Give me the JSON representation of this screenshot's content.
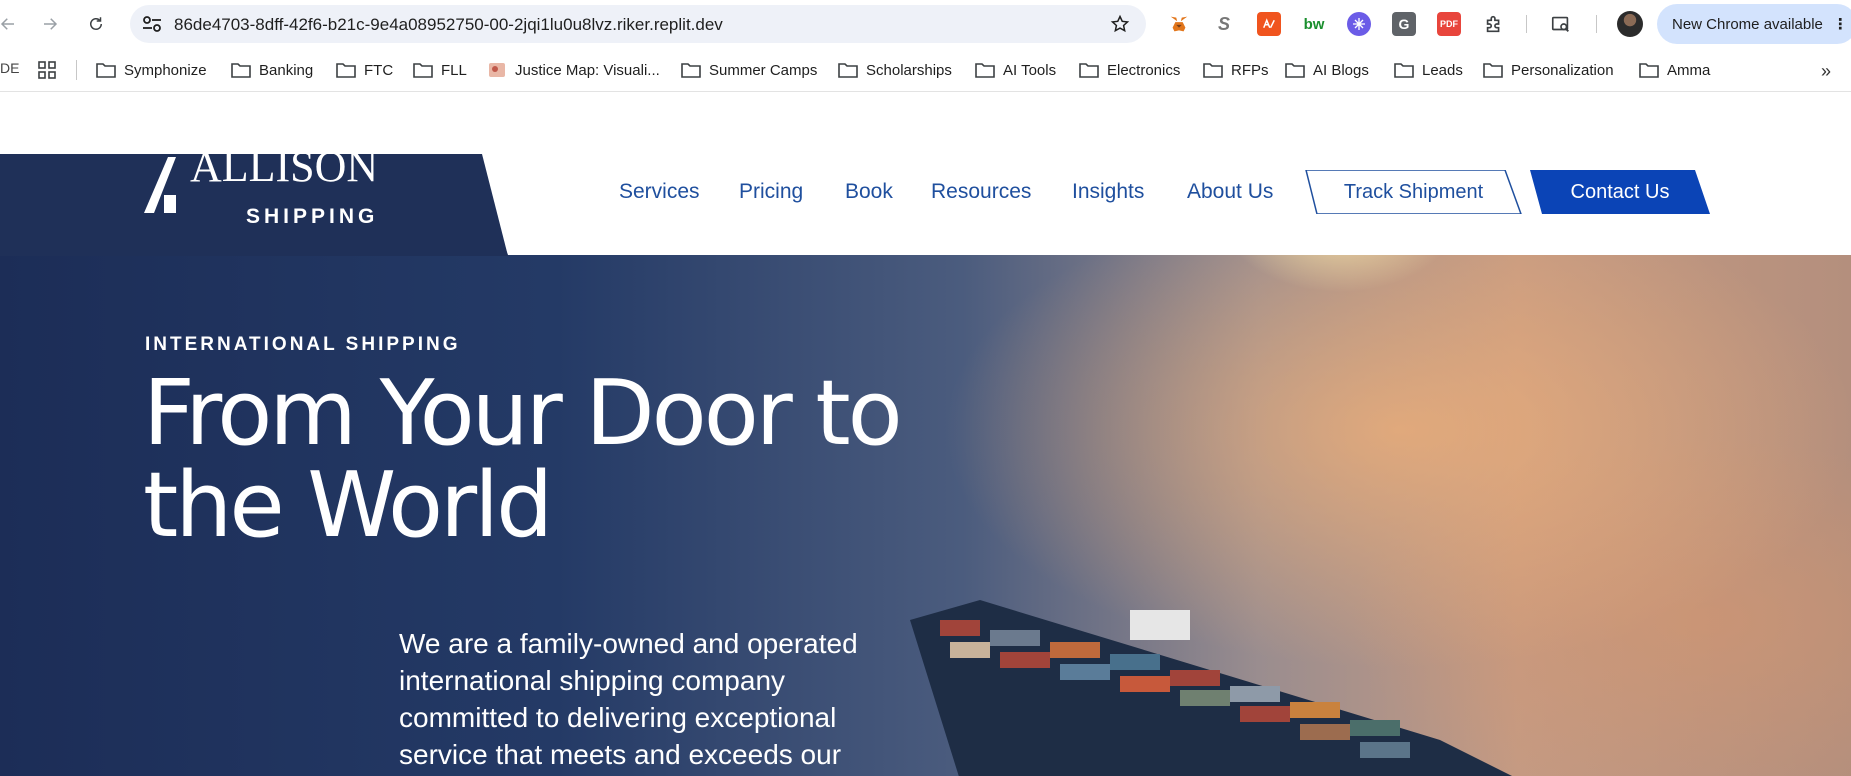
{
  "browser": {
    "url": "86de4703-8dff-42f6-b21c-9e4a08952750-00-2jqi1lu0u8lvz.riker.replit.dev",
    "update_label": "New Chrome available",
    "extensions": [
      "metamask-icon",
      "s-extension-icon",
      "pdf-tool-icon",
      "bw-icon",
      "snowflake-icon",
      "g-icon",
      "pdf-icon",
      "puzzle-icon"
    ],
    "extension_text": {
      "g": "G",
      "bw": "bw",
      "pdf": "PDF",
      "s": "S"
    }
  },
  "bookmarks": {
    "edge_label": "DE",
    "items": [
      {
        "label": "Symphonize"
      },
      {
        "label": "Banking"
      },
      {
        "label": "FTC"
      },
      {
        "label": "FLL"
      },
      {
        "label": "Justice Map: Visuali..."
      },
      {
        "label": "Summer Camps"
      },
      {
        "label": "Scholarships"
      },
      {
        "label": "AI Tools"
      },
      {
        "label": "Electronics"
      },
      {
        "label": "RFPs"
      },
      {
        "label": "AI Blogs"
      },
      {
        "label": "Leads"
      },
      {
        "label": "Personalization"
      },
      {
        "label": "Amma"
      }
    ]
  },
  "site": {
    "logo": {
      "word": "ALLISON",
      "sub": "SHIPPING"
    },
    "nav": [
      "Services",
      "Pricing",
      "Book",
      "Resources",
      "Insights",
      "About Us"
    ],
    "track_label": "Track Shipment",
    "contact_label": "Contact Us",
    "hero": {
      "eyebrow": "INTERNATIONAL SHIPPING",
      "headline_line1": "From Your Door to",
      "headline_line2": "the World",
      "body": "We are a family-owned and operated international shipping company committed to delivering exceptional service that meets and exceeds our"
    },
    "colors": {
      "brand_navy": "#1f3058",
      "nav_blue": "#1f4f9e",
      "cta_blue": "#0b44b6"
    }
  }
}
